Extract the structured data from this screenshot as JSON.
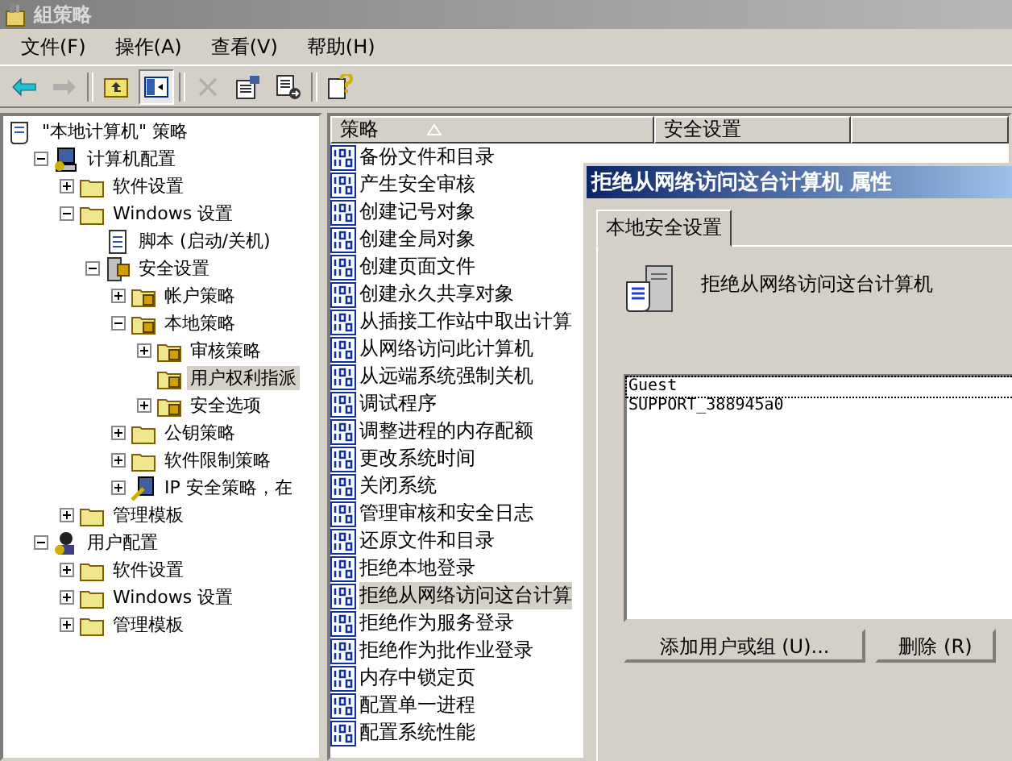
{
  "window": {
    "title": "組策略"
  },
  "menu": [
    "文件(F)",
    "操作(A)",
    "查看(V)",
    "帮助(H)"
  ],
  "toolbar": [
    {
      "kind": "back",
      "disabled": false,
      "pressed": false
    },
    {
      "kind": "forward",
      "disabled": true,
      "pressed": false
    },
    {
      "kind": "sep"
    },
    {
      "kind": "up",
      "disabled": false,
      "pressed": false
    },
    {
      "kind": "tree",
      "disabled": false,
      "pressed": true
    },
    {
      "kind": "sep"
    },
    {
      "kind": "delete",
      "disabled": true,
      "pressed": false
    },
    {
      "kind": "properties",
      "disabled": false,
      "pressed": false
    },
    {
      "kind": "export",
      "disabled": false,
      "pressed": false
    },
    {
      "kind": "sep"
    },
    {
      "kind": "help",
      "disabled": false,
      "pressed": false
    }
  ],
  "tree": [
    {
      "label": "\"本地计算机\" 策略",
      "kind": "policy",
      "selected": false,
      "children": [
        {
          "label": "计算机配置",
          "kind": "computer",
          "expanded": true,
          "selected": false,
          "children": [
            {
              "label": "软件设置",
              "kind": "folder",
              "expanded": false,
              "selected": false
            },
            {
              "label": "Windows 设置",
              "kind": "folder",
              "expanded": true,
              "selected": false,
              "children": [
                {
                  "label": "脚本 (启动/关机)",
                  "kind": "script",
                  "selected": false
                },
                {
                  "label": "安全设置",
                  "kind": "security",
                  "expanded": true,
                  "selected": false,
                  "children": [
                    {
                      "label": "帐户策略",
                      "kind": "lockfolder",
                      "expanded": false,
                      "selected": false
                    },
                    {
                      "label": "本地策略",
                      "kind": "lockfolder",
                      "expanded": true,
                      "selected": false,
                      "children": [
                        {
                          "label": "审核策略",
                          "kind": "lockfolder",
                          "expanded": false,
                          "selected": false
                        },
                        {
                          "label": "用户权利指派",
                          "kind": "lockfolder",
                          "selected": true
                        },
                        {
                          "label": "安全选项",
                          "kind": "lockfolder",
                          "expanded": false,
                          "selected": false
                        }
                      ]
                    },
                    {
                      "label": "公钥策略",
                      "kind": "folder",
                      "expanded": false,
                      "selected": false
                    },
                    {
                      "label": "软件限制策略",
                      "kind": "folder",
                      "expanded": false,
                      "selected": false
                    },
                    {
                      "label": "IP 安全策略，在",
                      "kind": "ip",
                      "expanded": false,
                      "selected": false
                    }
                  ]
                }
              ]
            },
            {
              "label": "管理模板",
              "kind": "folder",
              "expanded": false,
              "selected": false
            }
          ]
        },
        {
          "label": "用户配置",
          "kind": "user",
          "expanded": true,
          "selected": false,
          "children": [
            {
              "label": "软件设置",
              "kind": "folder",
              "expanded": false,
              "selected": false
            },
            {
              "label": "Windows 设置",
              "kind": "folder",
              "expanded": false,
              "selected": false
            },
            {
              "label": "管理模板",
              "kind": "folder",
              "expanded": false,
              "selected": false
            }
          ]
        }
      ]
    }
  ],
  "list": {
    "columns": [
      "策略",
      "安全设置"
    ],
    "rows": [
      {
        "policy": "备份文件和目录",
        "selected": false
      },
      {
        "policy": "产生安全审核",
        "selected": false
      },
      {
        "policy": "创建记号对象",
        "selected": false
      },
      {
        "policy": "创建全局对象",
        "selected": false
      },
      {
        "policy": "创建页面文件",
        "selected": false
      },
      {
        "policy": "创建永久共享对象",
        "selected": false
      },
      {
        "policy": "从插接工作站中取出计算",
        "selected": false
      },
      {
        "policy": "从网络访问此计算机",
        "selected": false
      },
      {
        "policy": "从远端系统强制关机",
        "selected": false
      },
      {
        "policy": "调试程序",
        "selected": false
      },
      {
        "policy": "调整进程的内存配额",
        "selected": false
      },
      {
        "policy": "更改系统时间",
        "selected": false
      },
      {
        "policy": "关闭系统",
        "selected": false
      },
      {
        "policy": "管理审核和安全日志",
        "selected": false
      },
      {
        "policy": "还原文件和目录",
        "selected": false
      },
      {
        "policy": "拒绝本地登录",
        "selected": false
      },
      {
        "policy": "拒绝从网络访问这台计算",
        "selected": true
      },
      {
        "policy": "拒绝作为服务登录",
        "selected": false
      },
      {
        "policy": "拒绝作为批作业登录",
        "selected": false
      },
      {
        "policy": "内存中锁定页",
        "selected": false
      },
      {
        "policy": "配置单一进程",
        "selected": false
      },
      {
        "policy": "配置系统性能",
        "selected": false
      }
    ]
  },
  "dialog": {
    "title": "拒绝从网络访问这台计算机 属性",
    "tab": "本地安全设置",
    "heading": "拒绝从网络访问这台计算机",
    "entries": [
      {
        "name": "Guest",
        "selected": true
      },
      {
        "name": "SUPPORT_388945a0",
        "selected": false
      }
    ],
    "buttons": [
      "添加用户或组 (U)...",
      "删除 (R)"
    ]
  }
}
